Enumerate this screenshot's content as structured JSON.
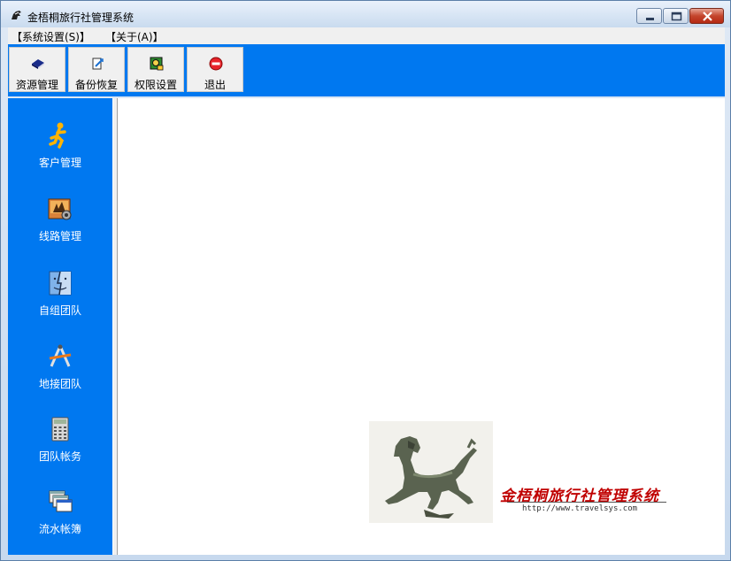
{
  "window": {
    "title": "金梧桐旅行社管理系统"
  },
  "menu": [
    {
      "label": "【系统设置(S)】"
    },
    {
      "label": "【关于(A)】"
    }
  ],
  "toolbar": [
    {
      "label": "资源管理",
      "icon": "book-icon"
    },
    {
      "label": "备份恢复",
      "icon": "backup-icon"
    },
    {
      "label": "权限设置",
      "icon": "permission-icon"
    },
    {
      "label": "退出",
      "icon": "exit-icon"
    }
  ],
  "sidebar": [
    {
      "label": "客户管理",
      "icon": "running-person-icon"
    },
    {
      "label": "线路管理",
      "icon": "travel-photo-icon"
    },
    {
      "label": "自组团队",
      "icon": "finder-icon"
    },
    {
      "label": "地接团队",
      "icon": "compass-icon"
    },
    {
      "label": "团队帐务",
      "icon": "calculator-icon"
    },
    {
      "label": "流水帐簿",
      "icon": "windows-icon"
    }
  ],
  "logo": {
    "name": "金梧桐旅行社管理系统",
    "url": "http://www.travelsys.com"
  },
  "colors": {
    "accent_blue": "#0078f0",
    "logo_red": "#c00000"
  }
}
